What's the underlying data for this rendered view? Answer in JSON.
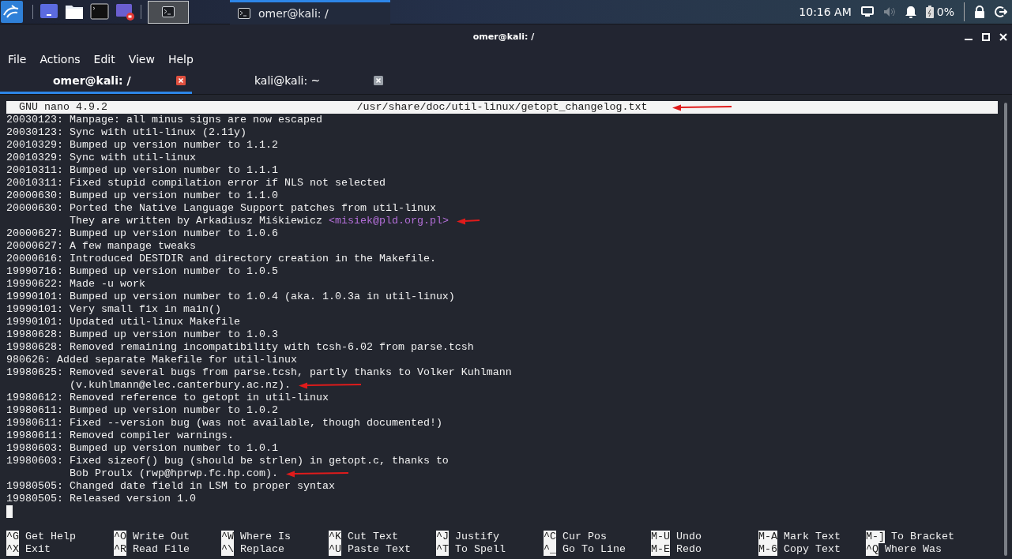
{
  "taskbar": {
    "launchers": [
      {
        "kind": "desktop"
      },
      {
        "kind": "folder"
      },
      {
        "kind": "terminal"
      },
      {
        "kind": "recorder"
      }
    ],
    "active_window_button": {
      "selected": true
    },
    "task": {
      "title": "omer@kali: /",
      "selected": true
    },
    "clock": "10:16 AM",
    "battery": "0%"
  },
  "window": {
    "title": "omer@kali: /"
  },
  "menu": [
    "File",
    "Actions",
    "Edit",
    "View",
    "Help"
  ],
  "tabs": [
    {
      "label": "omer@kali: /",
      "selected": true
    },
    {
      "label": "kali@kali: ~",
      "selected": false
    }
  ],
  "editor": {
    "app": "GNU nano 4.9.2",
    "file": "/usr/share/doc/util-linux/getopt_changelog.txt",
    "file_marked": true,
    "cursor": true,
    "lines": [
      {
        "kind": "entry",
        "text": "20030123: Manpage: all minus signs are now escaped",
        "marked": false
      },
      {
        "kind": "entry",
        "text": "20030123: Sync with util-linux (2.11y)",
        "marked": false
      },
      {
        "kind": "entry",
        "text": "20010329: Bumped up version number to 1.1.2",
        "marked": false
      },
      {
        "kind": "entry",
        "text": "20010329: Sync with util-linux",
        "marked": false
      },
      {
        "kind": "entry",
        "text": "20010311: Bumped up version number to 1.1.1",
        "marked": false
      },
      {
        "kind": "entry",
        "text": "20010311: Fixed stupid compilation error if NLS not selected",
        "marked": false
      },
      {
        "kind": "entry",
        "text": "20000630: Bumped up version number to 1.1.0",
        "marked": false
      },
      {
        "kind": "entry",
        "text": "20000630: Ported the Native Language Support patches from util-linux",
        "marked": false
      },
      {
        "kind": "continuation",
        "text": "They are written by Arkadiusz Miśkiewicz",
        "highlight": "<misiek@pld.org.pl>",
        "marked": true
      },
      {
        "kind": "entry",
        "text": "20000627: Bumped up version number to 1.0.6",
        "marked": false
      },
      {
        "kind": "entry",
        "text": "20000627: A few manpage tweaks",
        "marked": false
      },
      {
        "kind": "entry",
        "text": "20000616: Introduced DESTDIR and directory creation in the Makefile.",
        "marked": false
      },
      {
        "kind": "entry",
        "text": "19990716: Bumped up version number to 1.0.5",
        "marked": false
      },
      {
        "kind": "entry",
        "text": "19990622: Made -u work",
        "marked": false
      },
      {
        "kind": "entry",
        "text": "19990101: Bumped up version number to 1.0.4 (aka. 1.0.3a in util-linux)",
        "marked": false
      },
      {
        "kind": "entry",
        "text": "19990101: Very small fix in main()",
        "marked": false
      },
      {
        "kind": "entry",
        "text": "19990101: Updated util-linux Makefile",
        "marked": false
      },
      {
        "kind": "entry",
        "text": "19980628: Bumped up version number to 1.0.3",
        "marked": false
      },
      {
        "kind": "entry",
        "text": "19980628: Removed remaining incompatibility with tcsh-6.02 from parse.tcsh",
        "marked": false
      },
      {
        "kind": "entry",
        "text": "980626: Added separate Makefile for util-linux",
        "marked": false
      },
      {
        "kind": "entry",
        "text": "19980625: Removed several bugs from parse.tcsh, partly thanks to Volker Kuhlmann",
        "marked": false
      },
      {
        "kind": "continuation",
        "text": "(v.kuhlmann@elec.canterbury.ac.nz).",
        "marked": true
      },
      {
        "kind": "entry",
        "text": "19980612: Removed reference to getopt in util-linux",
        "marked": false
      },
      {
        "kind": "entry",
        "text": "19980611: Bumped up version number to 1.0.2",
        "marked": false
      },
      {
        "kind": "entry",
        "text": "19980611: Fixed --version bug (was not available, though documented!)",
        "marked": false
      },
      {
        "kind": "entry",
        "text": "19980611: Removed compiler warnings.",
        "marked": false
      },
      {
        "kind": "entry",
        "text": "19980603: Bumped up version number to 1.0.1",
        "marked": false
      },
      {
        "kind": "entry",
        "text": "19980603: Fixed sizeof() bug (should be strlen) in getopt.c, thanks to",
        "marked": false
      },
      {
        "kind": "continuation",
        "text": "Bob Proulx (rwp@hprwp.fc.hp.com).",
        "marked": true
      },
      {
        "kind": "entry",
        "text": "19980505: Changed date field in LSM to proper syntax",
        "marked": false
      },
      {
        "kind": "entry",
        "text": "19980505: Released version 1.0",
        "marked": false
      }
    ]
  },
  "shortcuts": [
    [
      {
        "key": "^G",
        "label": "Get Help"
      },
      {
        "key": "^O",
        "label": "Write Out"
      },
      {
        "key": "^W",
        "label": "Where Is"
      },
      {
        "key": "^K",
        "label": "Cut Text"
      },
      {
        "key": "^J",
        "label": "Justify"
      },
      {
        "key": "^C",
        "label": "Cur Pos"
      },
      {
        "key": "M-U",
        "label": "Undo"
      },
      {
        "key": "M-A",
        "label": "Mark Text"
      },
      {
        "key": "M-]",
        "label": "To Bracket"
      }
    ],
    [
      {
        "key": "^X",
        "label": "Exit"
      },
      {
        "key": "^R",
        "label": "Read File"
      },
      {
        "key": "^\\",
        "label": "Replace"
      },
      {
        "key": "^U",
        "label": "Paste Text"
      },
      {
        "key": "^T",
        "label": "To Spell"
      },
      {
        "key": "^_",
        "label": "Go To Line"
      },
      {
        "key": "M-E",
        "label": "Redo"
      },
      {
        "key": "M-6",
        "label": "Copy Text"
      },
      {
        "key": "^Q",
        "label": "Where Was"
      }
    ]
  ]
}
